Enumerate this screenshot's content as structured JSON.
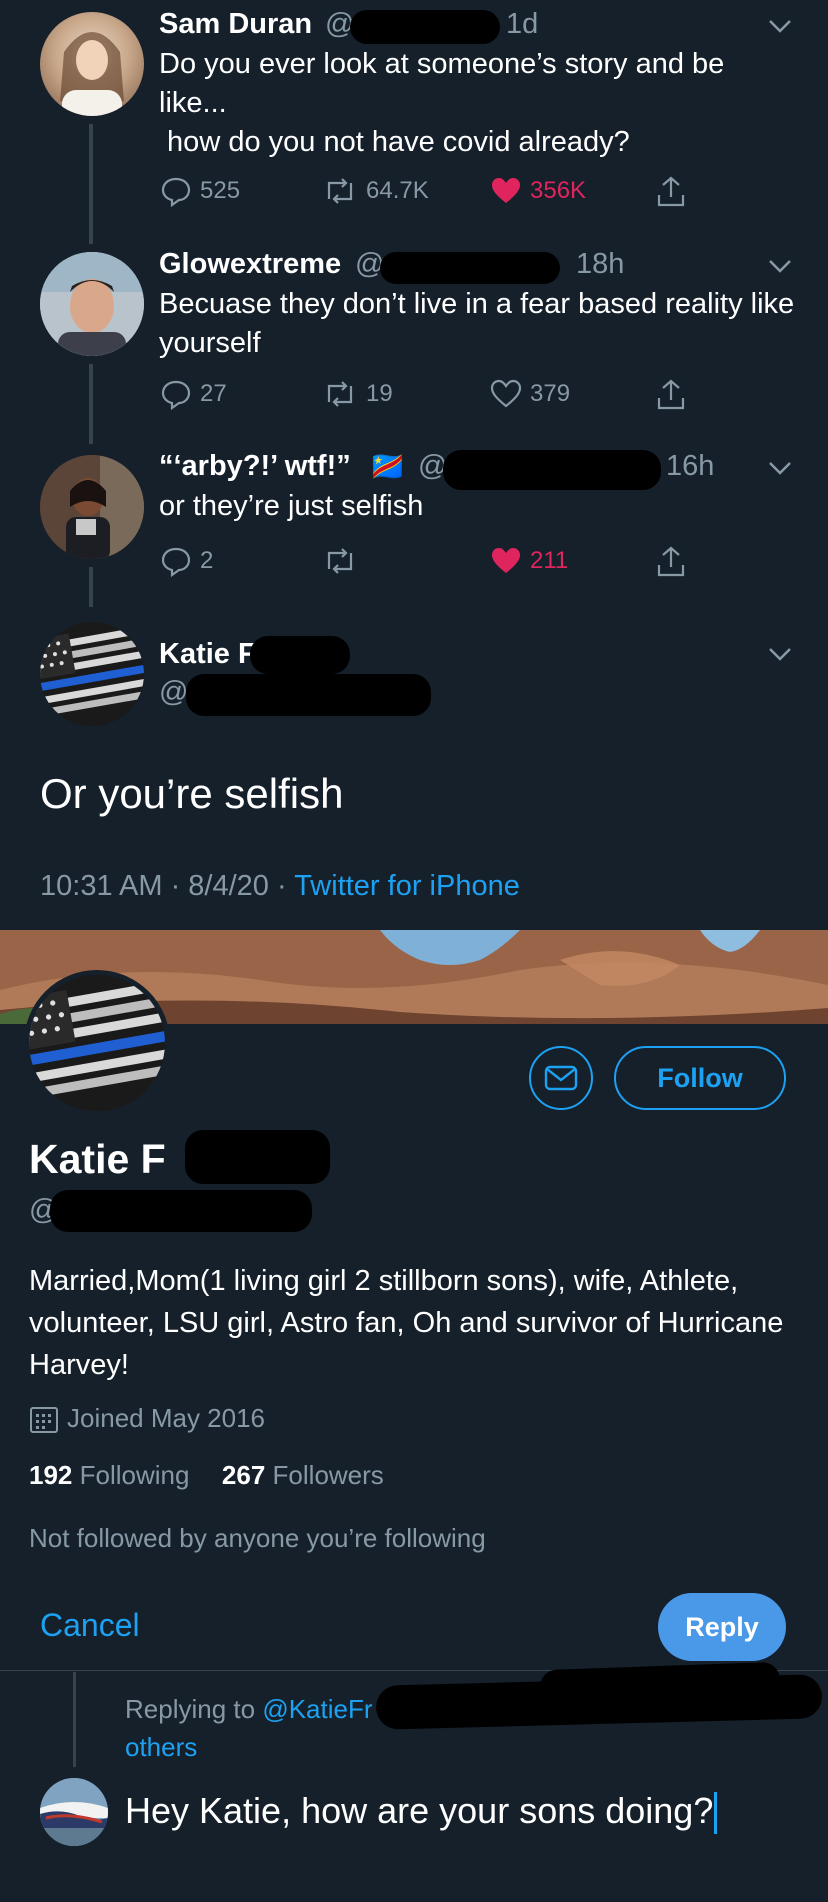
{
  "thread": [
    {
      "name": "Sam Duran",
      "handle_prefix": "@",
      "time": "1d",
      "text_lines": [
        "Do you ever look at someone’s story and be like...",
        " how do you not have covid already?"
      ],
      "replies": "525",
      "retweets": "64.7K",
      "likes": "356K",
      "liked": true
    },
    {
      "name": "Glowextreme",
      "handle_prefix": "@",
      "time": "18h",
      "text_lines": [
        "Becuase they don’t live in a fear based reality like yourself"
      ],
      "replies": "27",
      "retweets": "19",
      "likes": "379",
      "liked": false
    },
    {
      "name": "“‘arby?!’ wtf!”",
      "flag": "🇨🇩",
      "handle_prefix": "@",
      "time": "16h",
      "text_lines": [
        "or they’re just selfish"
      ],
      "replies": "2",
      "retweets": "",
      "likes": "211",
      "liked": true
    }
  ],
  "main_tweet": {
    "name": "Katie F",
    "handle_prefix": "@",
    "text": "Or you’re selfish",
    "timestamp": "10:31 AM · 8/4/20 · ",
    "source": "Twitter for iPhone"
  },
  "profile": {
    "name": "Katie F",
    "handle_prefix": "@",
    "follow_label": "Follow",
    "bio": "Married,Mom(1 living girl 2 stillborn sons), wife, Athlete, volunteer, LSU girl, Astro fan, Oh and survivor of Hurricane Harvey!",
    "joined": "Joined May 2016",
    "following_count": "192",
    "following_label": "Following",
    "followers_count": "267",
    "followers_label": "Followers",
    "not_followed": "Not followed by anyone you’re following"
  },
  "composer": {
    "cancel_label": "Cancel",
    "reply_label": "Reply",
    "replying_to_prefix": "Replying to ",
    "replying_to_handle": "@KatieFr",
    "replying_to_suffix": "others",
    "draft_text": "Hey Katie, how are your sons doing?"
  },
  "colors": {
    "background": "#15202b",
    "accent": "#1da1f2",
    "like": "#e0245e",
    "muted": "#8899a6"
  }
}
